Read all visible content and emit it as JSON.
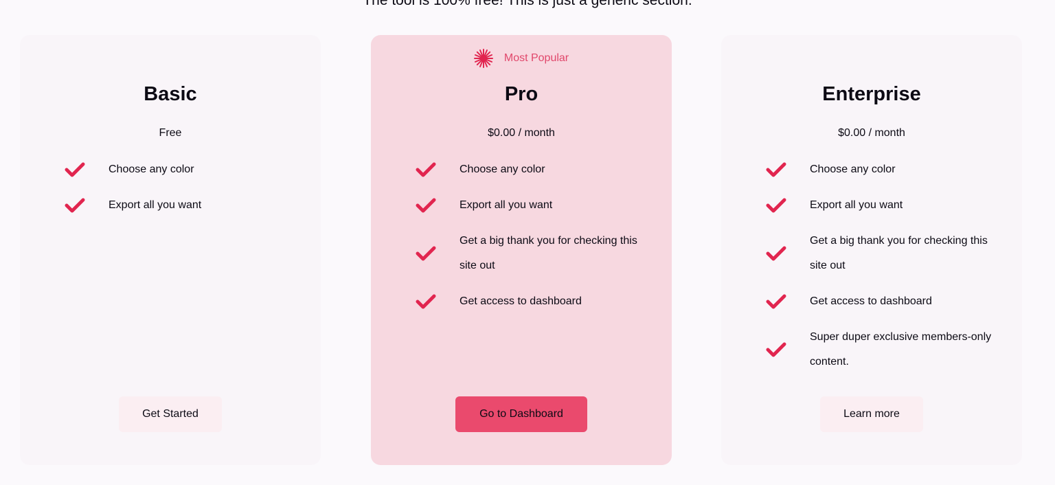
{
  "intro": "The tool is 100% free! This is just a generic section.",
  "colors": {
    "accent": "#e1254f",
    "pro_card": "#f7d8e0",
    "pro_button": "#ea4a6d"
  },
  "plans": {
    "basic": {
      "title": "Basic",
      "price": "Free",
      "features": [
        "Choose any color",
        "Export all you want"
      ],
      "button": "Get Started"
    },
    "pro": {
      "badge": "Most Popular",
      "badge_icon": "starburst-icon",
      "title": "Pro",
      "price": "$0.00 / month",
      "features": [
        "Choose any color",
        "Export all you want",
        "Get a big thank you for checking this site out",
        "Get access to dashboard"
      ],
      "button": "Go to Dashboard"
    },
    "enterprise": {
      "title": "Enterprise",
      "price": "$0.00 / month",
      "features": [
        "Choose any color",
        "Export all you want",
        "Get a big thank you for checking this site out",
        "Get access to dashboard",
        "Super duper exclusive members-only content."
      ],
      "button": "Learn more"
    }
  }
}
